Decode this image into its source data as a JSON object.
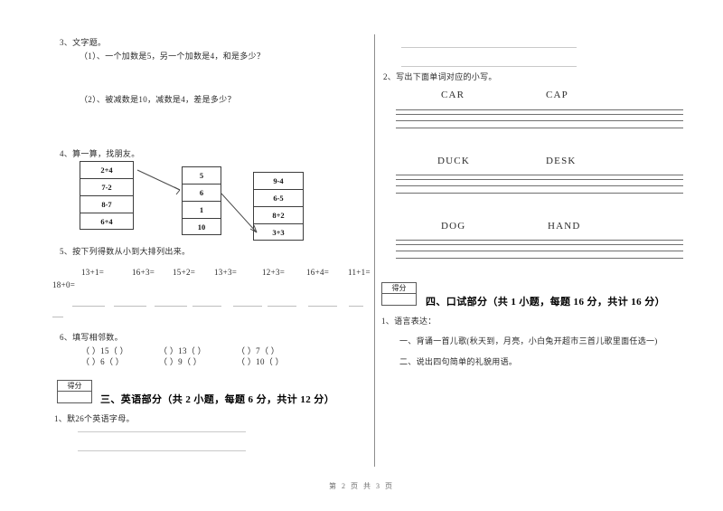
{
  "page": {
    "footer": "第 2 页 共 3 页",
    "score_box_label": "得分"
  },
  "left_column": {
    "q3": {
      "heading": "3、文字题。",
      "items": [
        "（1）、一个加数是5，另一个加数是4，和是多少？",
        "（2）、被减数是10，减数是4，差是多少？"
      ]
    },
    "q4": {
      "heading": "4、算一算，找朋友。",
      "box_left": [
        "2+4",
        "7-2",
        "8-7",
        "6+4"
      ],
      "box_middle": [
        "5",
        "6",
        "1",
        "10"
      ],
      "box_right": [
        "9-4",
        "6-5",
        "8+2",
        "3+3"
      ]
    },
    "q5": {
      "heading": "5、按下列得数从小到大排列出来。",
      "expressions": [
        "13+1=",
        "16+3=",
        "15+2=",
        "13+3=",
        "12+3=",
        "16+4=",
        "11+1=",
        "18+0="
      ]
    },
    "q6": {
      "heading": "6、填写相邻数。",
      "row1": [
        "（  ）15（  ）",
        "（  ）13（  ）",
        "（  ）7（  ）"
      ],
      "row2": [
        "（  ）6（  ）",
        "（  ）9（  ）",
        "（  ）10（  ）"
      ]
    },
    "section3": {
      "title": "三、英语部分（共 2 小题，每题 6 分，共计 12 分）",
      "q1": "1、默26个英语字母。"
    }
  },
  "right_column": {
    "section3_cont": {
      "q2": "2、写出下面单词对应的小写。",
      "word_rows": [
        [
          "CAR",
          "CAP"
        ],
        [
          "DUCK",
          "DESK"
        ],
        [
          "DOG",
          "HAND"
        ]
      ]
    },
    "section4": {
      "title": "四、口试部分（共 1 小题，每题 16 分，共计 16 分）",
      "q1": "1、语言表达：",
      "items": [
        "一、背诵一首儿歌(秋天到，月亮，小白兔开超市三首儿歌里面任选一)",
        "二、说出四句简单的礼貌用语。"
      ]
    }
  }
}
